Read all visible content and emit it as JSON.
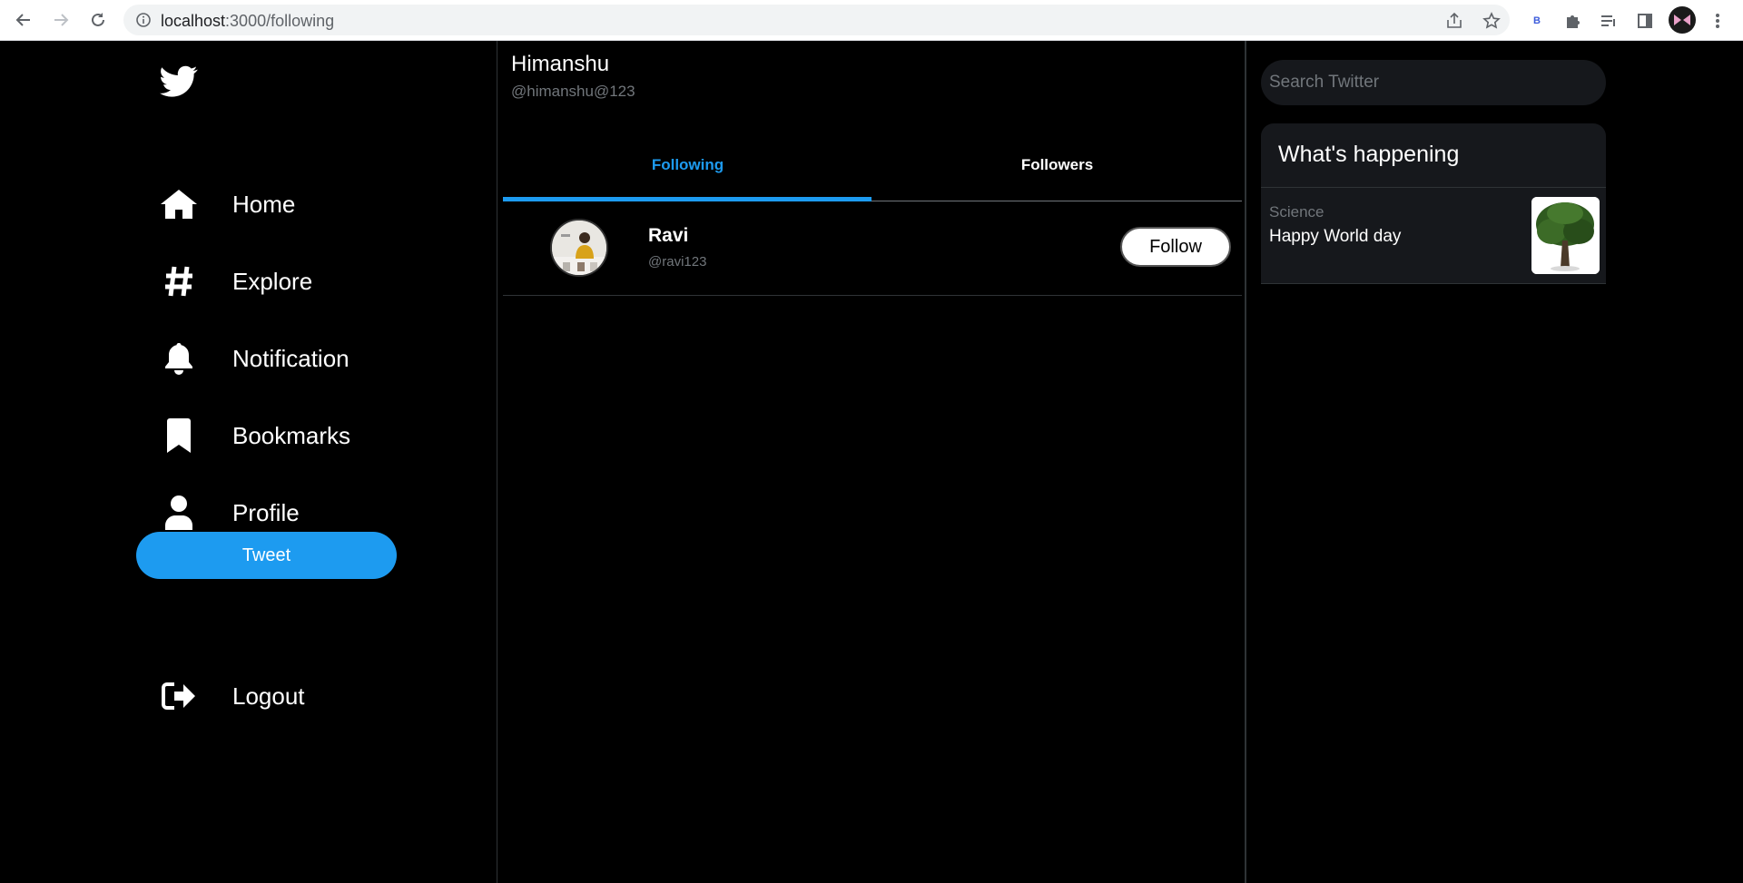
{
  "browser": {
    "url_host": "localhost",
    "url_path": ":3000/following",
    "extension_letter": "B"
  },
  "sidebar": {
    "items": [
      {
        "label": "Home",
        "icon": "home-icon"
      },
      {
        "label": "Explore",
        "icon": "hashtag-icon"
      },
      {
        "label": "Notification",
        "icon": "bell-icon"
      },
      {
        "label": "Bookmarks",
        "icon": "bookmark-icon"
      },
      {
        "label": "Profile",
        "icon": "user-icon"
      }
    ],
    "tweet_label": "Tweet",
    "logout_label": "Logout"
  },
  "header": {
    "name": "Himanshu",
    "handle": "@himanshu@123"
  },
  "tabs": [
    {
      "label": "Following",
      "active": true
    },
    {
      "label": "Followers",
      "active": false
    }
  ],
  "following": [
    {
      "name": "Ravi",
      "handle": "@ravi123",
      "button": "Follow"
    }
  ],
  "right": {
    "search_placeholder": "Search Twitter",
    "happening_title": "What's happening",
    "trend": {
      "category": "Science",
      "headline": "Happy World day"
    }
  },
  "colors": {
    "accent": "#1d9bf0",
    "background": "#000000",
    "panel": "#16181c"
  }
}
